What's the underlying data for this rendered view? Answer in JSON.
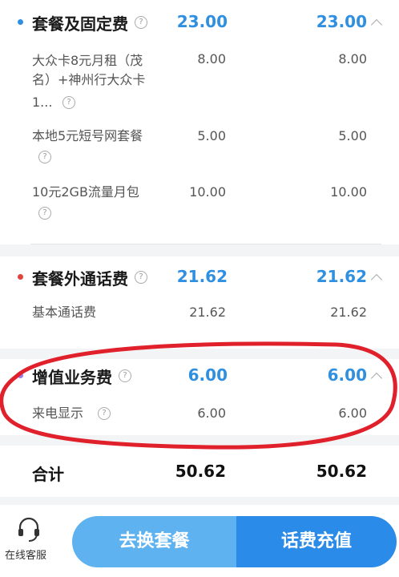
{
  "sections": [
    {
      "title": "套餐及固定费",
      "value1": "23.00",
      "value2": "23.00",
      "dot_color": "#2f8fe0",
      "items": [
        {
          "label_lines": [
            "大众卡8元月租（茂",
            "名）+神州行大众卡",
            "1..."
          ],
          "value1": "8.00",
          "value2": "8.00"
        },
        {
          "label_lines": [
            "本地5元短号网套餐"
          ],
          "value1": "5.00",
          "value2": "5.00"
        },
        {
          "label_lines": [
            "10元2GB流量月包"
          ],
          "value1": "10.00",
          "value2": "10.00"
        }
      ]
    },
    {
      "title": "套餐外通话费",
      "value1": "21.62",
      "value2": "21.62",
      "dot_color": "#e0443c",
      "items": [
        {
          "label_lines": [
            "基本通话费"
          ],
          "value1": "21.62",
          "value2": "21.62"
        }
      ]
    },
    {
      "title": "增值业务费",
      "value1": "6.00",
      "value2": "6.00",
      "dot_color": "#9b7be8",
      "items": [
        {
          "label_lines": [
            "来电显示"
          ],
          "value1": "6.00",
          "value2": "6.00"
        }
      ]
    }
  ],
  "total": {
    "label": "合计",
    "value1": "50.62",
    "value2": "50.62"
  },
  "bottom": {
    "customer_service_label": "在线客服",
    "change_plan_label": "去换套餐",
    "recharge_label": "话费充值"
  },
  "colors": {
    "accent": "#2f8fe0",
    "highlight_ellipse": "#e0202a"
  }
}
